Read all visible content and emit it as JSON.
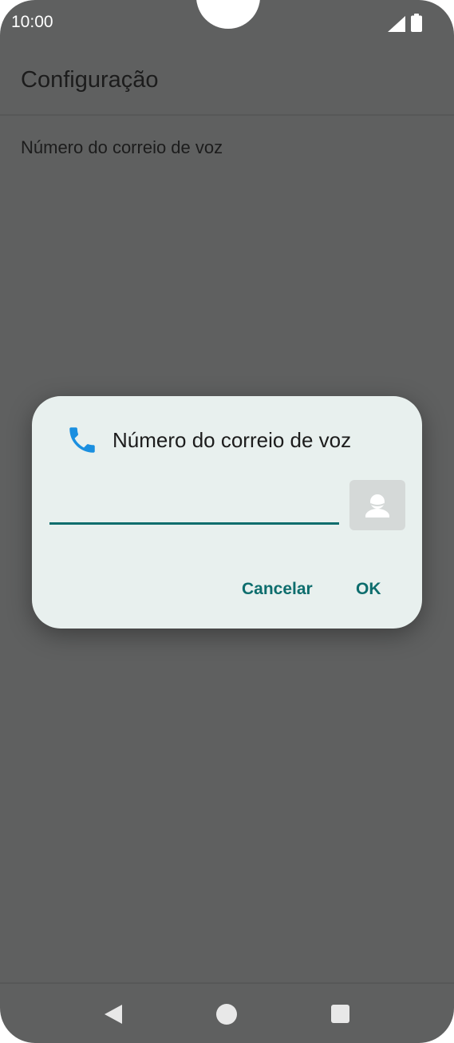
{
  "status_bar": {
    "time": "10:00"
  },
  "app_bar": {
    "title": "Configuração"
  },
  "preferences": [
    {
      "label": "Número do correio de voz"
    }
  ],
  "dialog": {
    "icon": "phone-icon",
    "title": "Número do correio de voz",
    "input": {
      "value": "",
      "placeholder": ""
    },
    "contact_picker_icon": "contact-icon",
    "cancel_label": "Cancelar",
    "ok_label": "OK"
  },
  "nav_bar": {
    "back_icon": "back-icon",
    "home_icon": "home-icon",
    "recents_icon": "recents-icon"
  },
  "colors": {
    "scrim_background": "#5f6060",
    "dialog_background": "#e8f0ee",
    "accent": "#0d6d6d",
    "phone_icon_blue": "#1a8fe0"
  }
}
